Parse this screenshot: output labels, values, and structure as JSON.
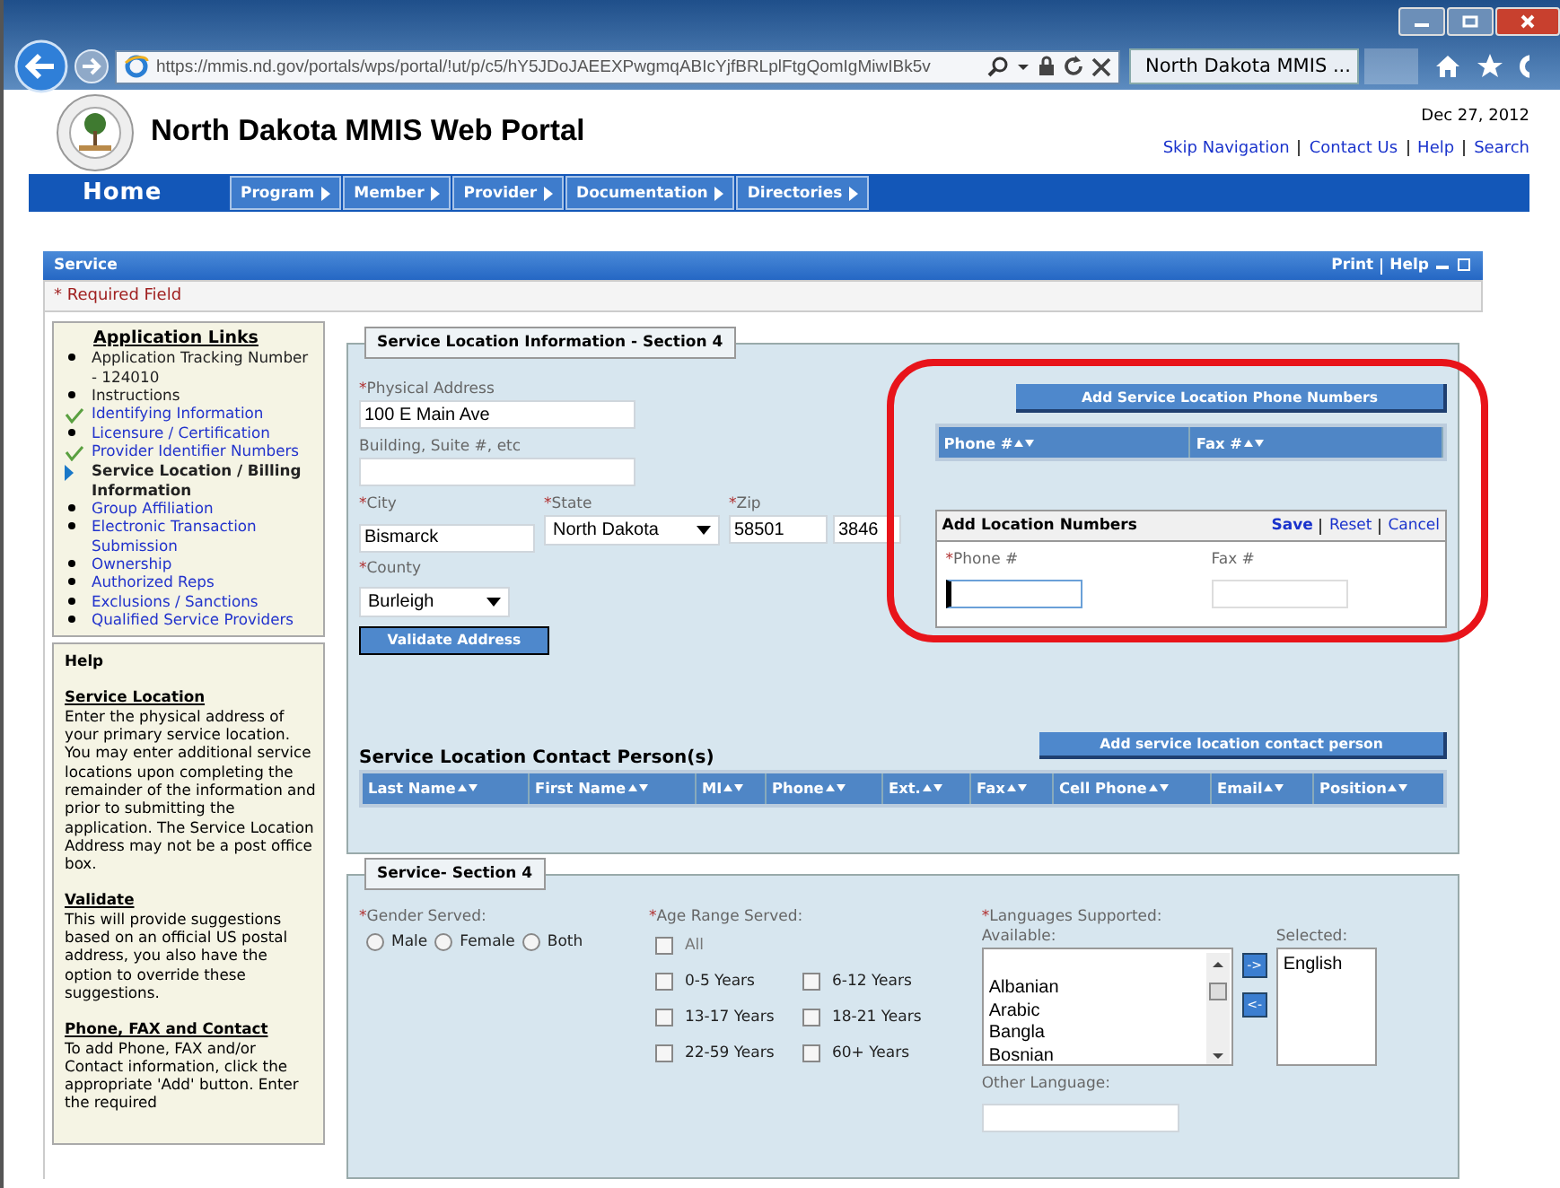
{
  "browser": {
    "url": "https://mmis.nd.gov/portals/wps/portal/!ut/p/c5/hY5JDoJAEEXPwgmqABIcYjfBRLplFtgQomIgMiwIBk5v",
    "tab": "North Dakota MMIS ..."
  },
  "header": {
    "title": "North Dakota MMIS Web Portal",
    "date": "Dec 27, 2012",
    "links": [
      "Skip Navigation",
      "Contact Us",
      "Help",
      "Search"
    ]
  },
  "nav": {
    "home": "Home",
    "items": [
      "Program",
      "Member",
      "Provider",
      "Documentation",
      "Directories"
    ]
  },
  "panel": {
    "title": "Service",
    "actions": [
      "Print",
      "Help"
    ],
    "required_note": "* Required Field"
  },
  "sidebar": {
    "links_title": "Application Links",
    "links": [
      {
        "label": "Application Tracking Number - 124010",
        "kind": "text"
      },
      {
        "label": "Instructions",
        "kind": "text"
      },
      {
        "label": "Identifying Information",
        "kind": "done"
      },
      {
        "label": "Licensure / Certification",
        "kind": "link"
      },
      {
        "label": "Provider Identifier Numbers",
        "kind": "done"
      },
      {
        "label": "Service Location / Billing Information",
        "kind": "current"
      },
      {
        "label": "Group Affiliation",
        "kind": "link"
      },
      {
        "label": "Electronic Transaction Submission",
        "kind": "link"
      },
      {
        "label": "Ownership",
        "kind": "link"
      },
      {
        "label": "Authorized Reps",
        "kind": "link"
      },
      {
        "label": "Exclusions / Sanctions",
        "kind": "link"
      },
      {
        "label": "Qualified Service Providers",
        "kind": "link"
      }
    ],
    "help_title": "Help",
    "help": [
      {
        "heading": "Service Location",
        "text": "Enter the physical address of your primary service location. You may enter additional service locations upon completing the remainder of the information and prior to submitting the application. The Service Location Address may not be a post office box."
      },
      {
        "heading": "Validate",
        "text": "This will provide suggestions based on an official US postal address, you also have the option to override these suggestions."
      },
      {
        "heading": "Phone, FAX and Contact",
        "text": "To add Phone, FAX and/or Contact information, click the appropriate 'Add' button. Enter the required"
      }
    ]
  },
  "location": {
    "legend": "Service Location Information - Section 4",
    "address": {
      "mark": "*",
      "label": "Physical Address",
      "value": "100 E Main Ave"
    },
    "building": {
      "label": "Building, Suite #, etc"
    },
    "city": {
      "mark": "*",
      "label": "City",
      "value": "Bismarck"
    },
    "state": {
      "mark": "*",
      "label": "State",
      "value": "North Dakota"
    },
    "zip": {
      "mark": "*",
      "label": "Zip",
      "value": "58501",
      "extension": "3846"
    },
    "county": {
      "mark": "*",
      "label": "County",
      "value": "Burleigh"
    },
    "validate_button": "Validate Address",
    "phone_button": "Add Service Location Phone Numbers",
    "phone_columns": [
      "Phone #",
      "Fax #"
    ],
    "add_numbers": {
      "title": "Add Location Numbers",
      "actions": [
        {
          "label": "Save",
          "primary": true
        },
        {
          "label": "Reset",
          "primary": false
        },
        {
          "label": "Cancel",
          "primary": false
        }
      ],
      "phone": {
        "mark": "*",
        "label": "Phone #",
        "focused": true
      },
      "fax": {
        "label": "Fax #",
        "focused": false
      }
    },
    "contacts_title": "Service Location Contact Person(s)",
    "contact_button": "Add service location contact person",
    "contact_columns": [
      "Last Name",
      "First Name",
      "MI",
      "Phone",
      "Ext.",
      "Fax",
      "Cell Phone",
      "Email",
      "Position"
    ]
  },
  "service": {
    "legend": "Service- Section 4",
    "gender": {
      "mark": "*",
      "label": "Gender Served:",
      "options": [
        {
          "label": "Male",
          "selected": false
        },
        {
          "label": "Female",
          "selected": false
        },
        {
          "label": "Both",
          "selected": false
        }
      ]
    },
    "age": {
      "mark": "*",
      "label": "Age Range Served:",
      "all": {
        "label": "All",
        "checked": false
      },
      "options": [
        {
          "label": "0-5 Years",
          "checked": false
        },
        {
          "label": "6-12 Years",
          "checked": false
        },
        {
          "label": "13-17 Years",
          "checked": false
        },
        {
          "label": "18-21 Years",
          "checked": false
        },
        {
          "label": "22-59 Years",
          "checked": false
        },
        {
          "label": "60+ Years",
          "checked": false
        }
      ]
    },
    "languages": {
      "mark": "*",
      "label": "Languages Supported:",
      "available_label": "Available:",
      "available": [
        "Albanian",
        "Arabic",
        "Bangla",
        "Bosnian"
      ],
      "add": "->",
      "remove": "<-",
      "selected_label": "Selected:",
      "selected": [
        "English"
      ],
      "other_label": "Other Language:"
    }
  }
}
